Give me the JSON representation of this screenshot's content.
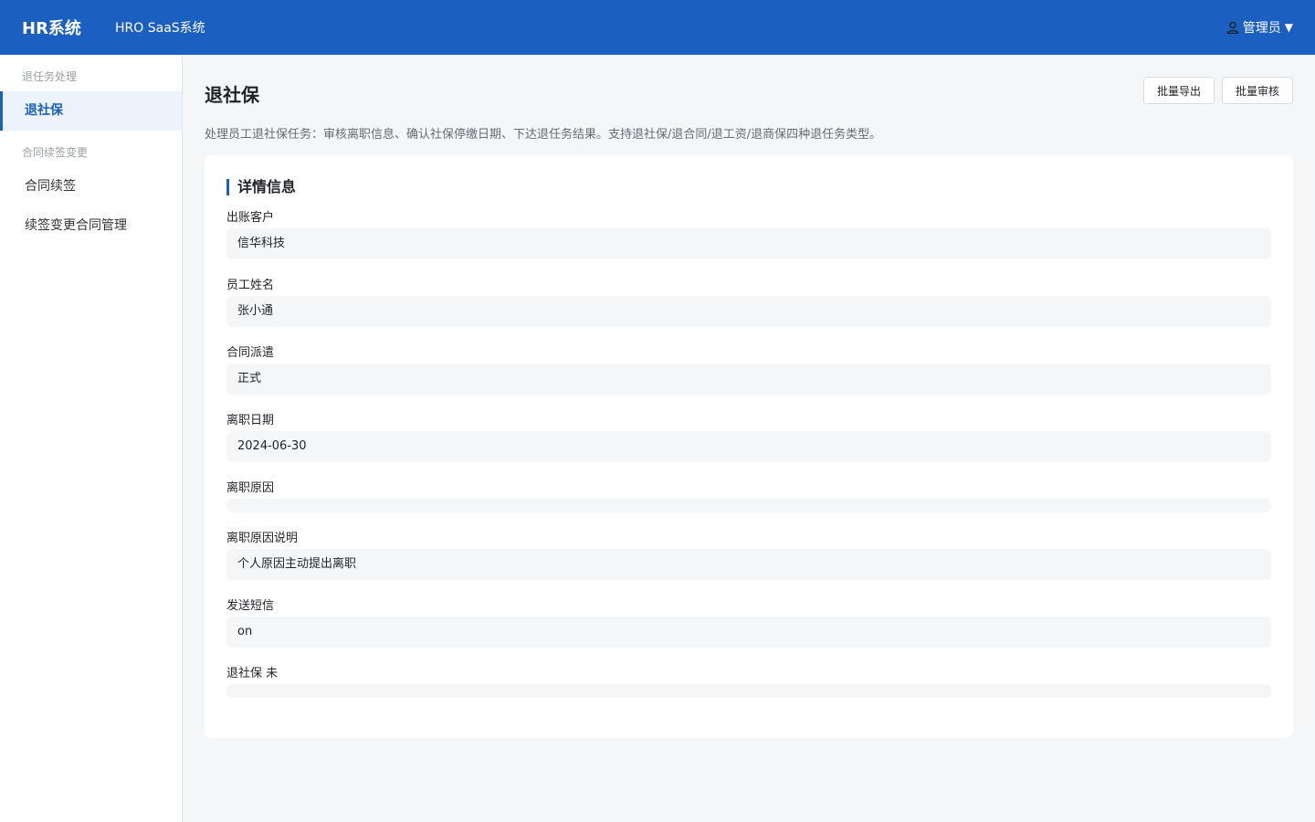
{
  "header": {
    "brand": "HR系统",
    "subtitle": "HRO SaaS系统",
    "user": "管理员",
    "caret": "▼"
  },
  "sidebar": {
    "groups": [
      {
        "title": "退任务处理",
        "items": [
          {
            "label": "退社保",
            "active": true
          }
        ]
      },
      {
        "title": "合同续签变更",
        "items": [
          {
            "label": "合同续签"
          },
          {
            "label": "续签变更合同管理"
          }
        ]
      }
    ]
  },
  "page": {
    "title": "退社保",
    "description": "处理员工退社保任务：审核离职信息、确认社保停缴日期、下达退任务结果。支持退社保/退合同/退工资/退商保四种退任务类型。",
    "actions": {
      "export": "批量导出",
      "review": "批量审核"
    }
  },
  "detail": {
    "title": "详情信息",
    "fields": [
      {
        "label": "出账客户",
        "value": "信华科技"
      },
      {
        "label": "员工姓名",
        "value": "张小通"
      },
      {
        "label": "合同派遣",
        "value": "正式"
      },
      {
        "label": "离职日期",
        "value": "2024-06-30"
      },
      {
        "label": "离职原因",
        "value": ""
      },
      {
        "label": "离职原因说明",
        "value": "个人原因主动提出离职"
      },
      {
        "label": "发送短信",
        "value": "on"
      },
      {
        "label": "退社保 未",
        "value": ""
      }
    ]
  }
}
